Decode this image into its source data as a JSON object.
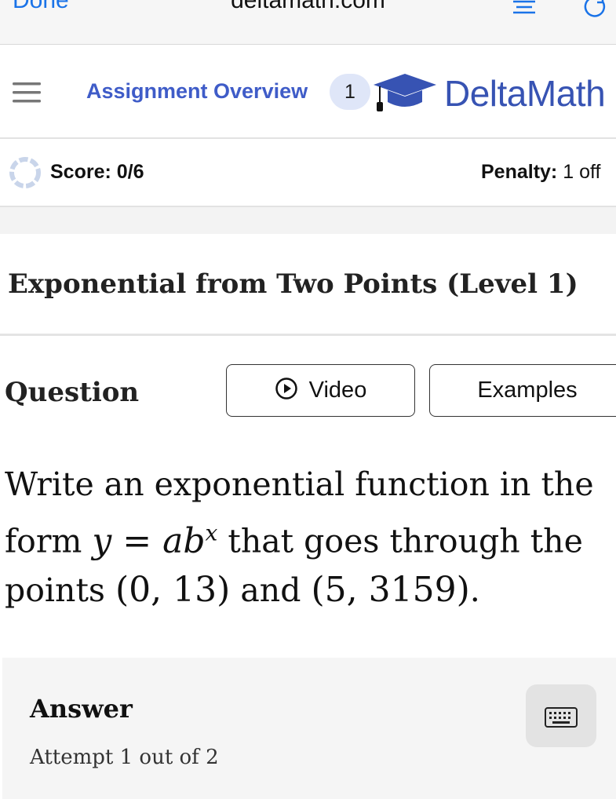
{
  "browser": {
    "done_label": "Done",
    "url": "deltamath.com"
  },
  "nav": {
    "assignment_overview": "Assignment Overview",
    "badge_count": "1",
    "brand": "DeltaMath"
  },
  "score": {
    "text": "Score: 0/6",
    "penalty_label": "Penalty:",
    "penalty_value": "1 off"
  },
  "problem": {
    "title": "Exponential from Two Points (Level 1)",
    "question_label": "Question",
    "video_label": "Video",
    "examples_label": "Examples",
    "line1": "Write an exponential function in the",
    "line2_pre": "form",
    "line2_math_lhs": "y",
    "line2_math_eq": " = ",
    "line2_math_a": "a",
    "line2_math_b": "b",
    "line2_math_exp": "x",
    "line2_post": "that goes through the",
    "line3_pre": "points",
    "point1": "(0, 13)",
    "line3_mid": "and",
    "point2": "(5, 3159)",
    "line3_end": "."
  },
  "answer": {
    "label": "Answer",
    "attempt": "Attempt 1 out of 2"
  },
  "colors": {
    "accent_blue": "#3f5cc8",
    "brand_blue": "#3753b3",
    "badge_bg": "#dfe6f8"
  },
  "icons": [
    "reader-icon",
    "reload-icon",
    "hamburger-icon",
    "graduation-cap-icon",
    "progress-ring-icon",
    "play-icon",
    "keyboard-icon"
  ]
}
